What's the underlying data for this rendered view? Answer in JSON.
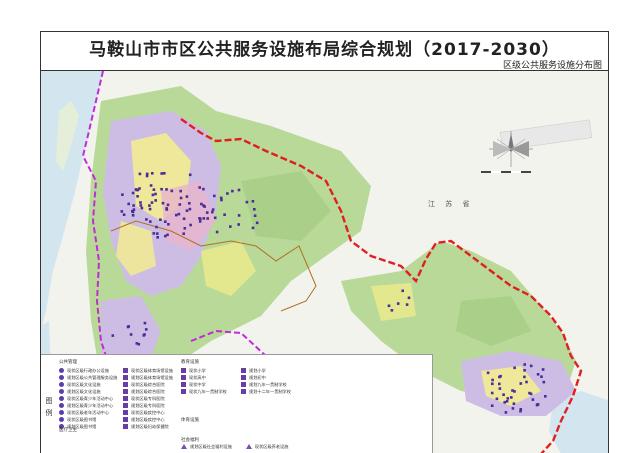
{
  "title": "马鞍山市市区公共服务设施布局综合规划（2017-2030）",
  "subtitle": "区级公共服务设施分布图",
  "map": {
    "province_label": "江 苏 省",
    "colors": {
      "water": "#d3e6f0",
      "land": "#f3f3ee",
      "green": "#b9d998",
      "urban_lavender": "#cdbde4",
      "urban_yellow": "#f5ee8c",
      "urban_pink": "#e9b4cc",
      "boundary_red": "#e02020",
      "boundary_purple": "#c02bd8",
      "district_brown": "#b07020",
      "facility": "#4a2d9a"
    },
    "compass_icon": "compass-rose-icon"
  },
  "legend": {
    "side_label": [
      "图",
      "例"
    ],
    "sections": {
      "public_management": "公共管理",
      "education": "教育设施",
      "medical": "医疗卫生",
      "sports": "体育设施",
      "social_welfare": "社会福利"
    },
    "col1": [
      "现状区级行政办公设施",
      "规划区级公共管理服务设施",
      "现状区级文化设施",
      "规划区级文化设施",
      "现状区级青少年活动中心",
      "规划区级青少年活动中心",
      "现状区级老年活动中心",
      "现状区级图书馆",
      "规划区级图书馆"
    ],
    "col2": [
      "现状区级体育场馆设施",
      "规划区级体育场馆设施",
      "现状区级综合医院",
      "规划区级综合医院",
      "现状区级专科医院",
      "规划区级专科医院",
      "现状区级疾控中心",
      "规划区级疾控中心",
      "规划区级妇幼保健院"
    ],
    "col3": [
      "现状小学",
      "现状高中",
      "现状中学",
      "现状九年一贯制学校"
    ],
    "col3b": [
      "规划小学",
      "规划初中",
      "规划九年一贯制学校",
      "规划十二年一贯制学校"
    ],
    "bottom_items": [
      "规划区级社会福利设施",
      "现状区级养老设施"
    ]
  }
}
